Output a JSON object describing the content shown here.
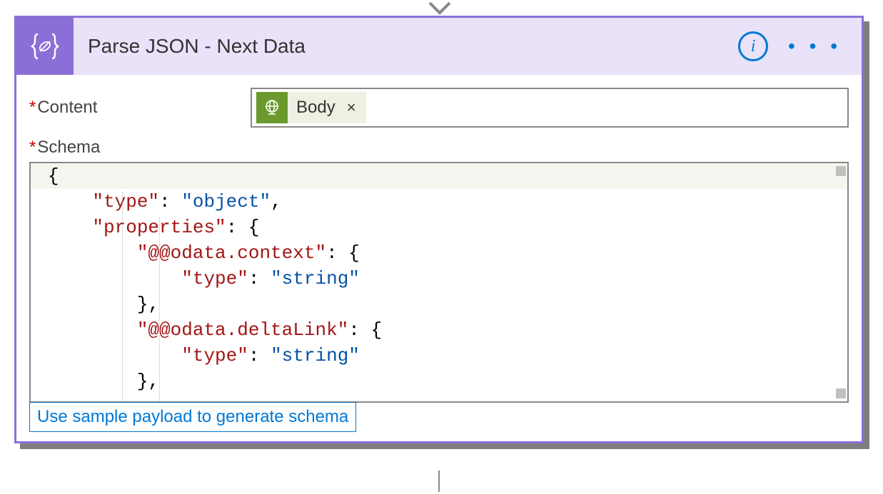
{
  "header": {
    "title": "Parse JSON - Next Data"
  },
  "fields": {
    "content_label": "Content",
    "schema_label": "Schema"
  },
  "token": {
    "label": "Body",
    "close": "×"
  },
  "schema": {
    "brace_open": "{",
    "line_type_key": "\"type\"",
    "line_type_val": "\"object\"",
    "line_props_key": "\"properties\"",
    "odata_context_key": "\"@@odata.context\"",
    "odata_delta_key": "\"@@odata.deltaLink\"",
    "type_key": "\"type\"",
    "string_val": "\"string\"",
    "brace_open2": "{",
    "brace_close": "}",
    "comma": ",",
    "colon": ":"
  },
  "actions": {
    "sample_payload": "Use sample payload to generate schema"
  },
  "icons": {
    "info": "i",
    "more": "• • •"
  }
}
